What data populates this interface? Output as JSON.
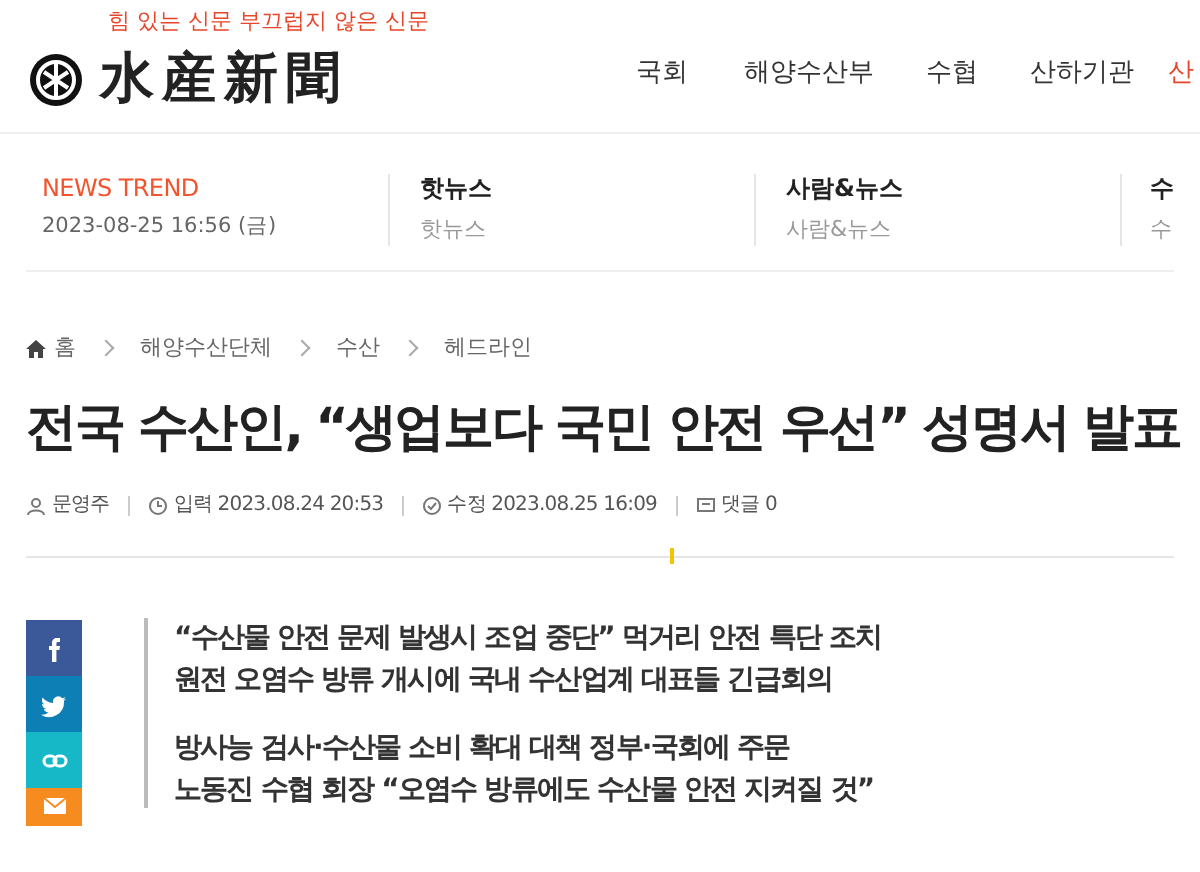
{
  "header": {
    "tagline": "힘 있는 신문 부끄럽지 않은 신문",
    "logo_text": "水産新聞"
  },
  "nav": [
    {
      "label": "국회",
      "selected": false
    },
    {
      "label": "해양수산부",
      "selected": false
    },
    {
      "label": "수협",
      "selected": false
    },
    {
      "label": "산하기관",
      "selected": false
    },
    {
      "label": "산",
      "selected": true
    }
  ],
  "trend": {
    "label": "NEWS TREND",
    "date": "2023-08-25 16:56 (금)",
    "columns": [
      {
        "title": "핫뉴스",
        "subtitle": "핫뉴스"
      },
      {
        "title": "사람&뉴스",
        "subtitle": "사람&뉴스"
      },
      {
        "title": "수",
        "subtitle": "수"
      }
    ]
  },
  "breadcrumb": [
    "홈",
    "해양수산단체",
    "수산",
    "헤드라인"
  ],
  "article": {
    "title": "전국 수산인, “생업보다 국민 안전 우선” 성명서 발표",
    "meta": [
      {
        "kind": "author",
        "text": "문영주"
      },
      {
        "kind": "posted",
        "text": "입력 2023.08.24 20:53"
      },
      {
        "kind": "edited",
        "text": "수정 2023.08.25 16:09"
      },
      {
        "kind": "comments",
        "text": "댓글 0"
      }
    ],
    "subtitles": [
      "“수산물 안전 문제 발생시 조업 중단” 먹거리 안전 특단 조치",
      "원전 오염수 방류 개시에 국내 수산업계 대표들 긴급회의",
      "방사능 검사·수산물 소비 확대 대책 정부·국회에 주문",
      "노동진 수협 회장 “오염수 방류에도 수산물 안전 지켜질 것”"
    ]
  },
  "share": [
    {
      "kind": "facebook",
      "color": "#3b5998"
    },
    {
      "kind": "twitter",
      "color": "#0e7fb4"
    },
    {
      "kind": "link",
      "color": "#16b8c8"
    },
    {
      "kind": "mail",
      "color": "#f68b1f"
    }
  ]
}
